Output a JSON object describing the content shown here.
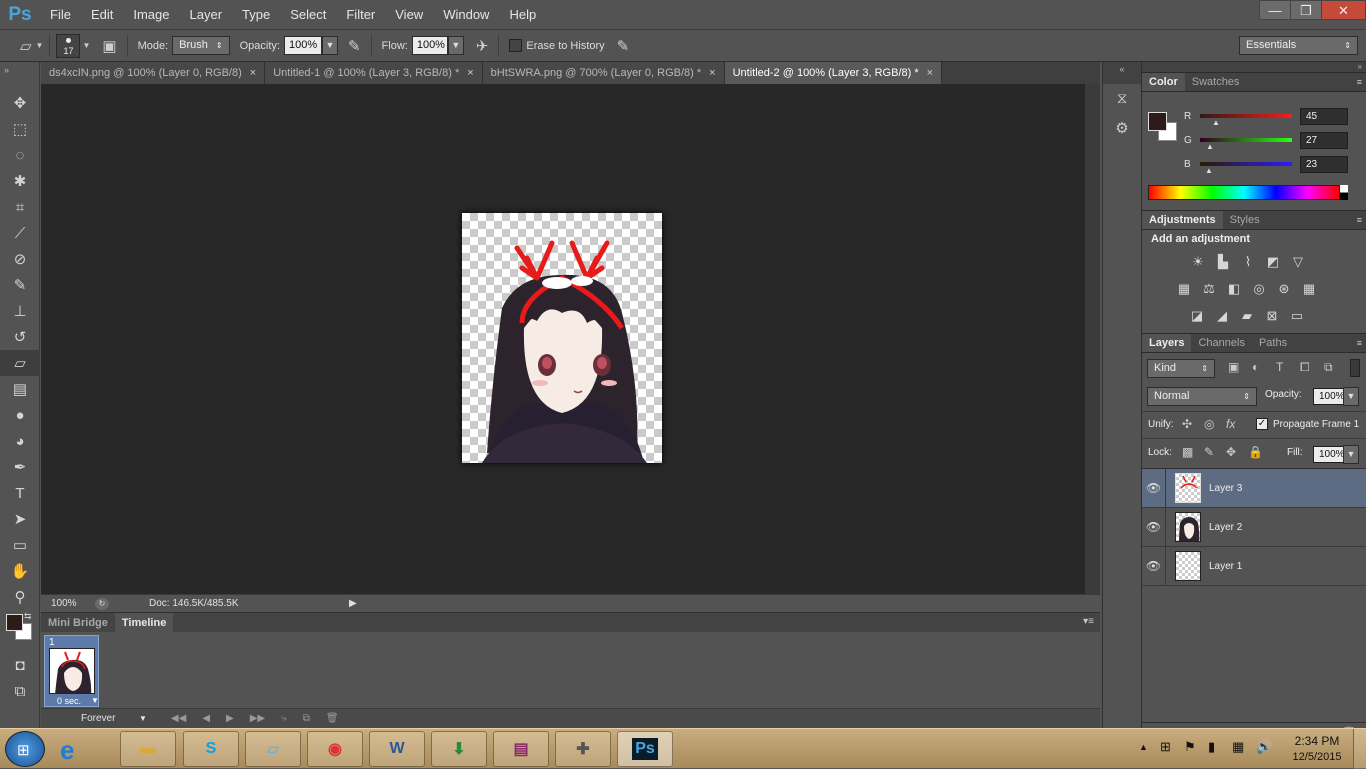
{
  "app": {
    "logo": "Ps"
  },
  "menu": [
    "File",
    "Edit",
    "Image",
    "Layer",
    "Type",
    "Select",
    "Filter",
    "View",
    "Window",
    "Help"
  ],
  "window_controls": {
    "minimize": "—",
    "restore": "❐",
    "close": "✕"
  },
  "options": {
    "brush_size": "17",
    "mode_label": "Mode:",
    "mode_value": "Brush",
    "opacity_label": "Opacity:",
    "opacity_value": "100%",
    "flow_label": "Flow:",
    "flow_value": "100%",
    "erase_history_label": "Erase to History",
    "workspace": "Essentials"
  },
  "tabs": [
    {
      "label": "ds4xcIN.png @ 100% (Layer 0, RGB/8)",
      "close": "×"
    },
    {
      "label": "Untitled-1 @ 100% (Layer 3, RGB/8) *",
      "close": "×"
    },
    {
      "label": "bHtSWRA.png @ 700% (Layer 0, RGB/8) *",
      "close": "×"
    },
    {
      "label": "Untitled-2 @ 100% (Layer 3, RGB/8) *",
      "close": "×"
    }
  ],
  "status": {
    "zoom": "100%",
    "doc": "Doc: 146.5K/485.5K"
  },
  "timeline": {
    "tab_mini_bridge": "Mini Bridge",
    "tab_timeline": "Timeline",
    "frame_number": "1",
    "frame_delay": "0 sec.",
    "loop": "Forever"
  },
  "color_panel": {
    "tab_color": "Color",
    "tab_swatches": "Swatches",
    "r_label": "R",
    "r_value": "45",
    "g_label": "G",
    "g_value": "27",
    "b_label": "B",
    "b_value": "23",
    "foreground": "#2d1b17"
  },
  "adjustments": {
    "tab_adjustments": "Adjustments",
    "tab_styles": "Styles",
    "heading": "Add an adjustment"
  },
  "layers_panel": {
    "tab_layers": "Layers",
    "tab_channels": "Channels",
    "tab_paths": "Paths",
    "kind": "Kind",
    "blend_mode": "Normal",
    "opacity_label": "Opacity:",
    "opacity_value": "100%",
    "unify_label": "Unify:",
    "propagate_label": "Propagate Frame 1",
    "lock_label": "Lock:",
    "fill_label": "Fill:",
    "fill_value": "100%",
    "layers": [
      {
        "name": "Layer 3"
      },
      {
        "name": "Layer 2"
      },
      {
        "name": "Layer 1"
      }
    ]
  },
  "taskbar": {
    "time": "2:34 PM",
    "date": "12/5/2015",
    "ps_label": "Ps",
    "word_label": "W"
  }
}
